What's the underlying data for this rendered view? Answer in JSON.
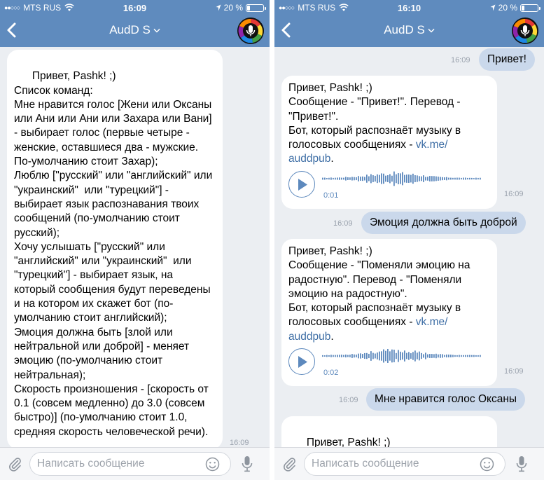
{
  "screens": [
    {
      "status": {
        "carrier": "MTS RUS",
        "time": "16:09",
        "battery": "20 %",
        "battery_level": 0.2
      },
      "title": "AudD S",
      "input": {
        "placeholder": "Написать сообщение"
      },
      "messages": [
        {
          "dir": "in",
          "text": "Привет, Pashk! ;)\nСписок команд:\nМне нравится голос [Жени или Оксаны или Ани или Ани или Захара или Вани] - выбирает голос (первые четыре - женские, оставшиеся два - мужские. По-умолчанию стоит Захар);\nЛюблю [\"русский\" или \"английский\" или \"украинский\"  или \"турецкий\"] - выбирает язык распознавания твоих сообщений (по-умолчанию стоит русский);\nХочу услышать [\"русский\" или \"английский\" или \"украинский\"  или \"турецкий\"] - выбирает язык, на который сообщения будут переведены и на котором их скажет бот (по-умолчанию стоит английский);\nЭмоция должна быть [злой или нейтральной или доброй] - меняет эмоцию (по-умолчанию стоит нейтральная);\nСкорость произношения - [скорость от 0.1 (совсем медленно) до 3.0 (совсем быстро)] (по-умолчанию стоит 1.0, средняя скорость человеческой речи).",
          "time": "16:09"
        }
      ]
    },
    {
      "status": {
        "carrier": "MTS RUS",
        "time": "16:10",
        "battery": "20 %",
        "battery_level": 0.2
      },
      "title": "AudD S",
      "input": {
        "placeholder": "Написать сообщение"
      },
      "messages": [
        {
          "dir": "out",
          "text": "Привет!",
          "time": "16:09"
        },
        {
          "dir": "in",
          "text": "Привет, Pashk! ;)\nСообщение - \"Привет!\". Перевод - \"Привет!\".\nБот, который распознаёт музыку в голосовых сообщениях - ",
          "link": "vk.me/\nauddpub",
          "link_end": ".",
          "voice_duration": "0:01",
          "time": "16:09"
        },
        {
          "dir": "out",
          "text": "Эмоция должна быть доброй",
          "time": "16:09"
        },
        {
          "dir": "in",
          "text": "Привет, Pashk! ;)\nСообщение - \"Поменяли эмоцию на радостную\". Перевод - \"Поменяли эмоцию на радостную\".\nБот, который распознаёт музыку в голосовых сообщениях - ",
          "link": "vk.me/\nauddpub",
          "link_end": ".",
          "voice_duration": "0:02",
          "time": "16:09"
        },
        {
          "dir": "out",
          "text": "Мне нравится голос Оксаны",
          "time": "16:09"
        },
        {
          "dir": "in",
          "text": "Привет, Pashk! ;)\nСообщение - \"Поменяли голос на"
        }
      ]
    }
  ]
}
